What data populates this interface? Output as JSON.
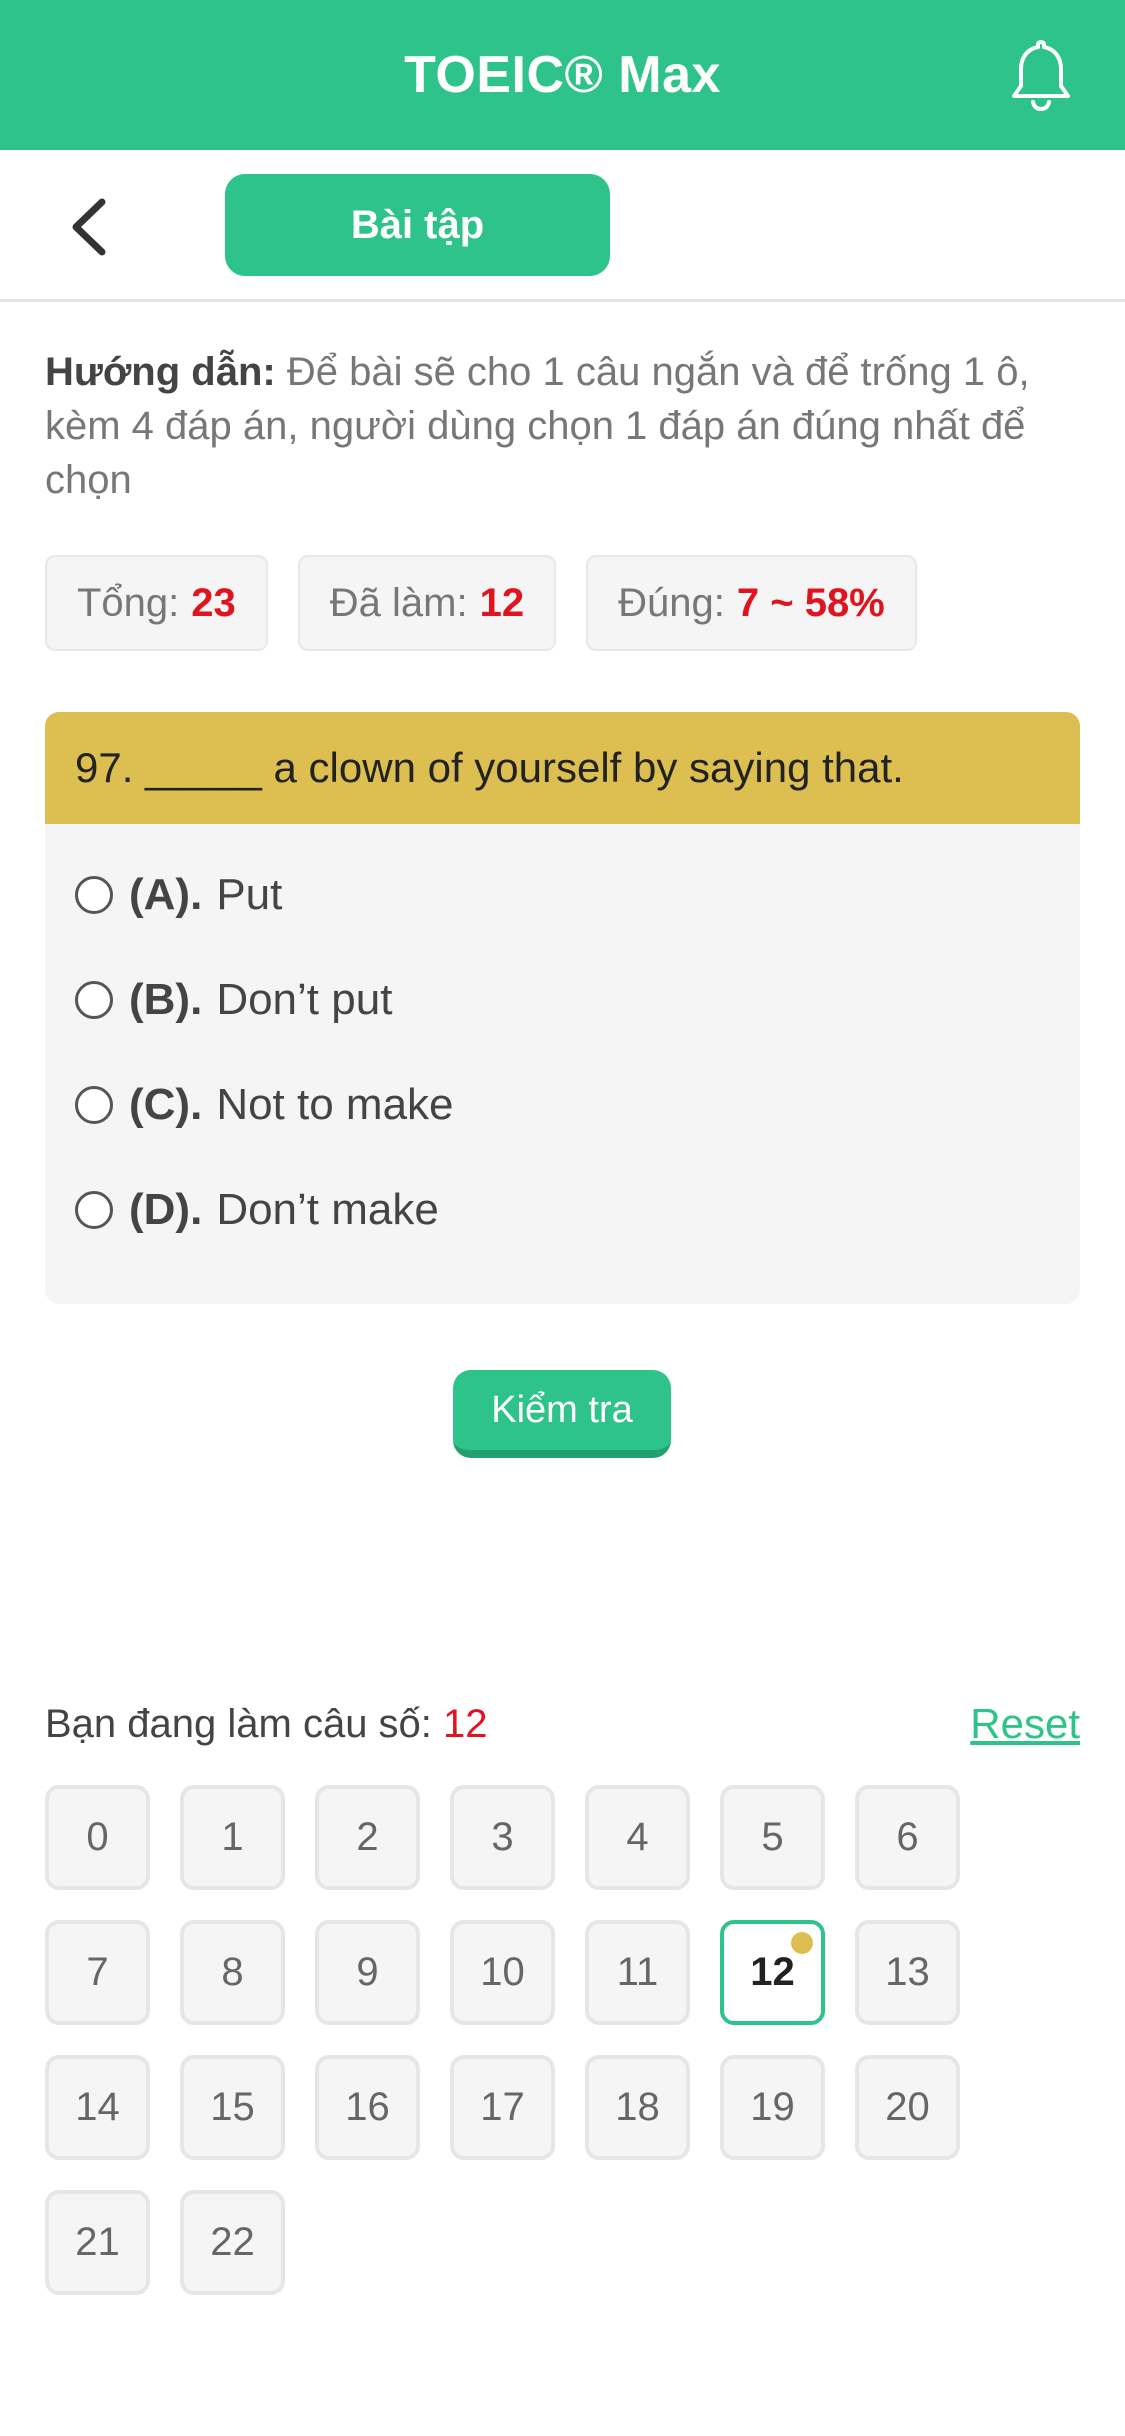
{
  "header": {
    "title": "TOEIC® Max",
    "icon": "bell-icon"
  },
  "subbar": {
    "back_icon": "chevron-left-icon",
    "tab_label": "Bài tập"
  },
  "guide": {
    "label": "Hướng dẫn:",
    "text": "Để bài sẽ cho 1 câu ngắn và để trống 1 ô, kèm 4 đáp án, người dùng chọn 1 đáp án đúng nhất để chọn"
  },
  "stats": {
    "total_label": "Tổng:",
    "total_value": "23",
    "done_label": "Đã làm:",
    "done_value": "12",
    "correct_label": "Đúng:",
    "correct_value": "7 ~ 58%"
  },
  "question": {
    "text": "97. _____ a clown of yourself by saying that.",
    "options": [
      {
        "letter": "(A).",
        "text": "Put"
      },
      {
        "letter": "(B).",
        "text": "Don’t put"
      },
      {
        "letter": "(C).",
        "text": "Not to make"
      },
      {
        "letter": "(D).",
        "text": "Don’t make"
      }
    ]
  },
  "check_button": "Kiểm tra",
  "progress": {
    "label": "Bạn đang làm câu số:",
    "current": "12",
    "reset": "Reset"
  },
  "grid": [
    "0",
    "1",
    "2",
    "3",
    "4",
    "5",
    "6",
    "7",
    "8",
    "9",
    "10",
    "11",
    "12",
    "13",
    "14",
    "15",
    "16",
    "17",
    "18",
    "19",
    "20",
    "21",
    "22"
  ],
  "colors": {
    "accent": "#2ec38a",
    "question_bg": "#dcbf50",
    "highlight": "#e0141e"
  }
}
